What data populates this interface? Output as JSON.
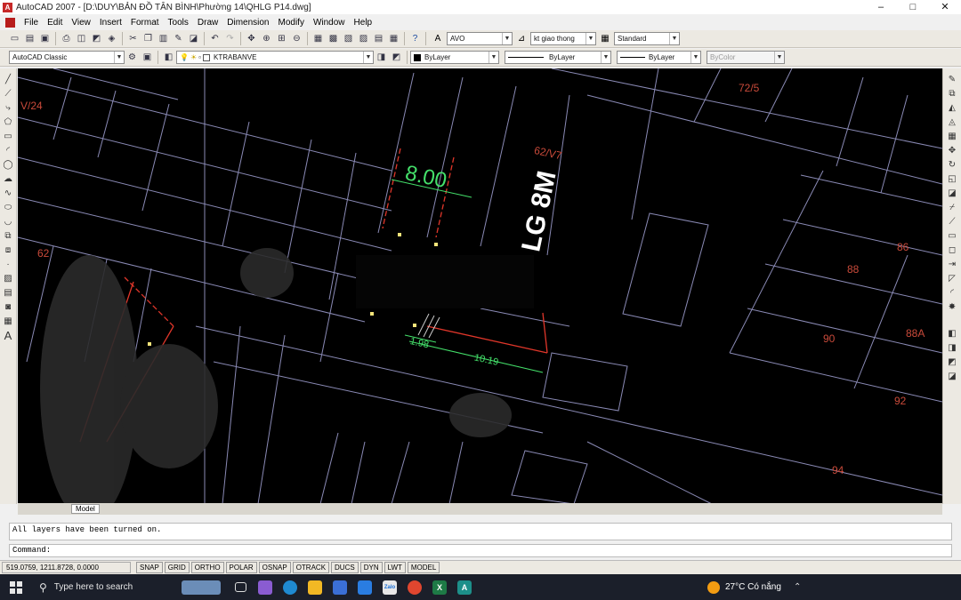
{
  "title": "AutoCAD 2007 - [D:\\DUY\\BẢN ĐỒ TÂN BÌNH\\Phường 14\\QHLG P14.dwg]",
  "window_controls": [
    "–",
    "□",
    "✕"
  ],
  "menu": [
    "File",
    "Edit",
    "View",
    "Insert",
    "Format",
    "Tools",
    "Draw",
    "Dimension",
    "Modify",
    "Window",
    "Help"
  ],
  "mdi_controls": [
    "–",
    "□",
    "✕"
  ],
  "toolbar": {
    "text_style": "AVO",
    "dim_style": "kt giao thong",
    "table_style": "Standard"
  },
  "layer_toolbar": {
    "workspace": "AutoCAD Classic",
    "layer": "KTRABANVE",
    "color": "ByLayer",
    "linetype": "ByLayer",
    "lineweight": "ByLayer",
    "plotstyle": "ByColor"
  },
  "drawing": {
    "road_label": "LG 8M",
    "dimension_width": "8.00",
    "lot_labels": [
      "V/24",
      "62/V7",
      "72/5",
      "86",
      "88",
      "88A",
      "90",
      "92",
      "94",
      "62"
    ],
    "small_dims": [
      "1.98",
      "10.19"
    ]
  },
  "model_tab": "Model",
  "command": {
    "history": "All layers have been turned on.",
    "prompt": "Command:"
  },
  "status": {
    "coords": "519.0759, 1211.8728, 0.0000",
    "buttons": [
      "SNAP",
      "GRID",
      "ORTHO",
      "POLAR",
      "OSNAP",
      "OTRACK",
      "DUCS",
      "DYN",
      "LWT",
      "MODEL"
    ]
  },
  "taskbar": {
    "search_placeholder": "Type here to search",
    "weather": "27°C  Có nắng",
    "colors": {
      "taskbar": "#1b1f2a",
      "canvas": "#000000",
      "lot_line": "#8a8ab5",
      "dim": "#44e06a",
      "red_line": "#e0362a"
    }
  }
}
